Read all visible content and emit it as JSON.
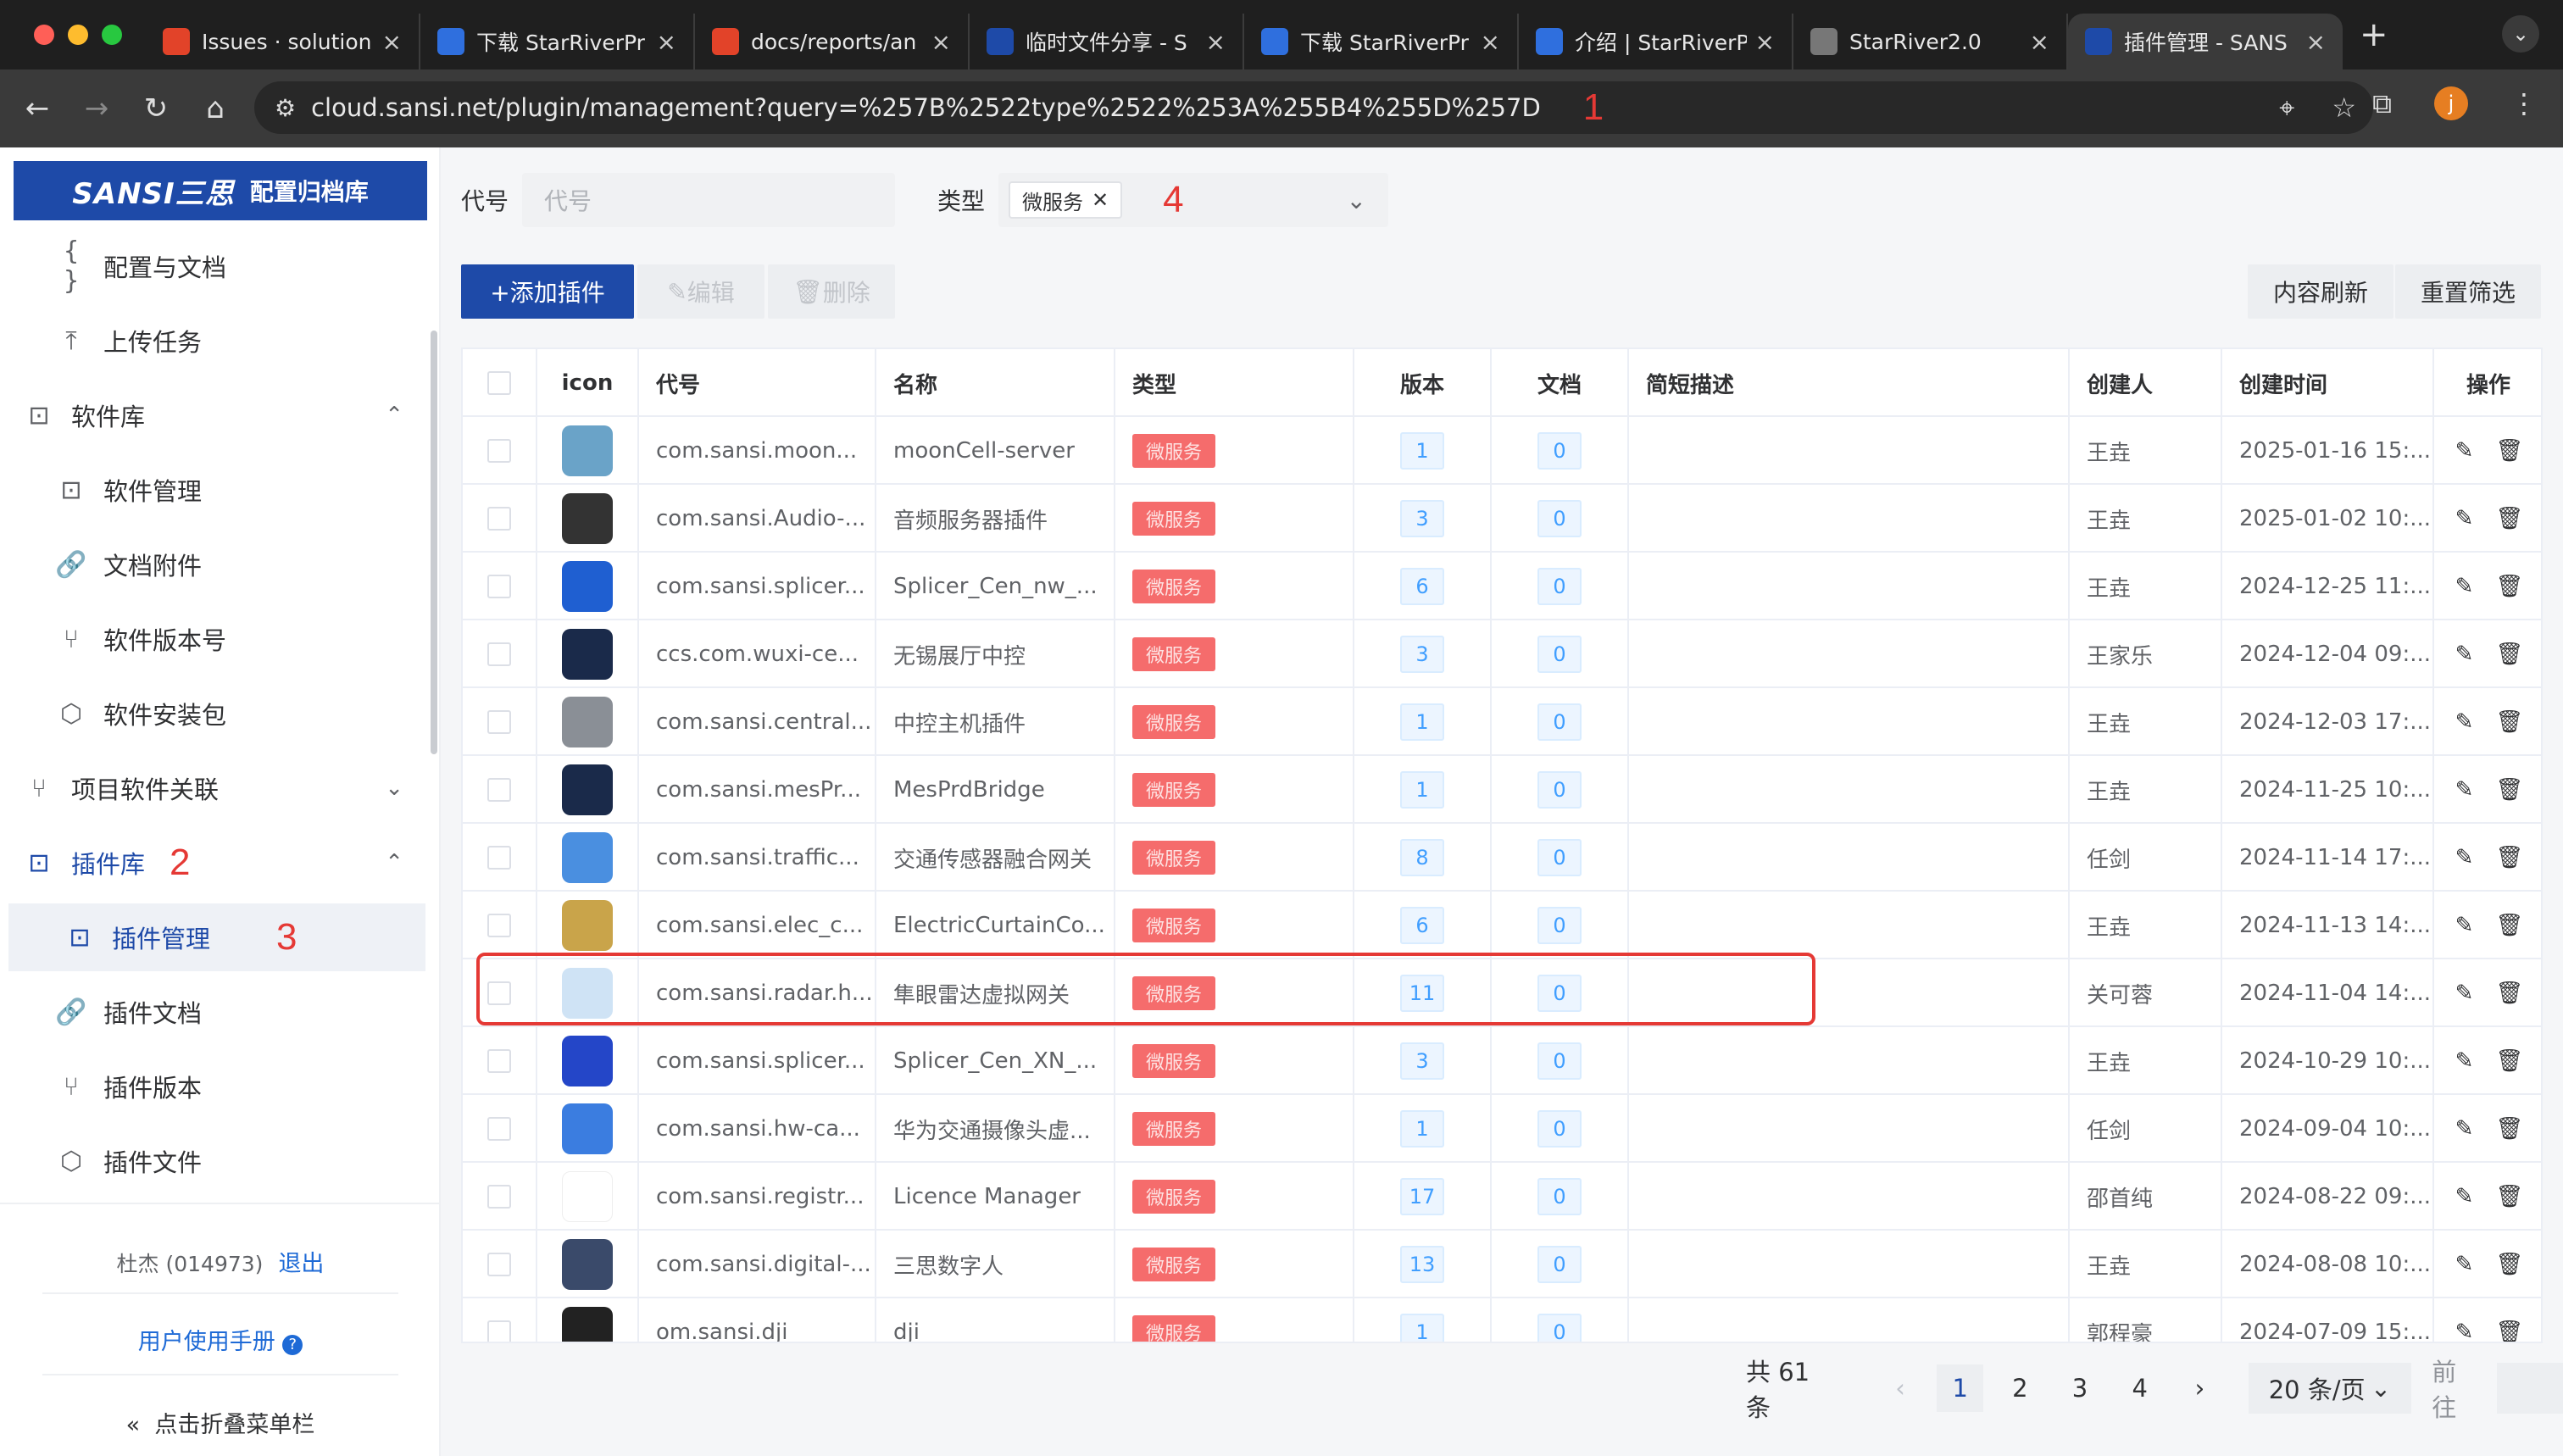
{
  "browser": {
    "tabs": [
      {
        "title": "Issues · solution",
        "fav": "gitlab-icon",
        "color": "#e24329"
      },
      {
        "title": "下载 StarRiverPr",
        "fav": "starriver-icon",
        "color": "#2f6fde"
      },
      {
        "title": "docs/reports/an",
        "fav": "gitlab-icon",
        "color": "#e24329"
      },
      {
        "title": "临时文件分享 - S",
        "fav": "sansi-icon",
        "color": "#1e4aa8"
      },
      {
        "title": "下载 StarRiverPr",
        "fav": "starriver-icon",
        "color": "#2f6fde"
      },
      {
        "title": "介绍 | StarRiverP",
        "fav": "starriver-icon",
        "color": "#2f6fde"
      },
      {
        "title": "StarRiver2.0",
        "fav": "globe-icon",
        "color": "#777777"
      },
      {
        "title": "插件管理 - SANS",
        "fav": "sansi-icon",
        "color": "#1e4aa8"
      }
    ],
    "url": "cloud.sansi.net/plugin/management?query=%257B%2522type%2522%253A%255B4%255D%257D",
    "annotation_1": "1"
  },
  "sidebar": {
    "logo_brand": "SANSI三思",
    "logo_text": "配置归档库",
    "items": [
      {
        "label": "配置与文档",
        "icon": "{ }"
      },
      {
        "label": "上传任务",
        "icon": "⤒"
      },
      {
        "label": "软件库",
        "icon": "⊡"
      },
      {
        "label": "软件管理",
        "icon": "⊡"
      },
      {
        "label": "文档附件",
        "icon": "🔗"
      },
      {
        "label": "软件版本号",
        "icon": "⑂"
      },
      {
        "label": "软件安装包",
        "icon": "⬡"
      },
      {
        "label": "项目软件关联",
        "icon": "⑂"
      },
      {
        "label": "插件库",
        "icon": "⊡"
      },
      {
        "label": "插件管理",
        "icon": "⊡"
      },
      {
        "label": "插件文档",
        "icon": "🔗"
      },
      {
        "label": "插件版本",
        "icon": "⑂"
      },
      {
        "label": "插件文件",
        "icon": "⬡"
      }
    ],
    "annotation_2": "2",
    "annotation_3": "3",
    "user": "杜杰 (014973)",
    "logout": "退出",
    "manual": "用户使用手册",
    "collapse": "点击折叠菜单栏"
  },
  "filters": {
    "code_label": "代号",
    "code_placeholder": "代号",
    "type_label": "类型",
    "type_value": "微服务",
    "annotation_4": "4"
  },
  "actions": {
    "add": "+添加插件",
    "edit": "编辑",
    "delete": "删除",
    "refresh": "内容刷新",
    "reset": "重置筛选"
  },
  "table": {
    "headers": [
      "icon",
      "代号",
      "名称",
      "类型",
      "版本",
      "文档",
      "简短描述",
      "创建人",
      "创建时间",
      "操作"
    ],
    "rows": [
      {
        "code": "com.sansi.moon...",
        "name": "moonCell-server",
        "type": "微服务",
        "version": "1",
        "docs": "0",
        "creator": "王垚",
        "created": "2025-01-16 15:...",
        "icon_color": "#6aa3c8"
      },
      {
        "code": "com.sansi.Audio-...",
        "name": "音频服务器插件",
        "type": "微服务",
        "version": "3",
        "docs": "0",
        "creator": "王垚",
        "created": "2025-01-02 10:...",
        "icon_color": "#333333"
      },
      {
        "code": "com.sansi.splicer...",
        "name": "Splicer_Cen_nw_...",
        "type": "微服务",
        "version": "6",
        "docs": "0",
        "creator": "王垚",
        "created": "2024-12-25 11:...",
        "icon_color": "#1f5fd1"
      },
      {
        "code": "ccs.com.wuxi-ce...",
        "name": "无锡展厅中控",
        "type": "微服务",
        "version": "3",
        "docs": "0",
        "creator": "王家乐",
        "created": "2024-12-04 09:...",
        "icon_color": "#1a2a4a"
      },
      {
        "code": "com.sansi.central...",
        "name": "中控主机插件",
        "type": "微服务",
        "version": "1",
        "docs": "0",
        "creator": "王垚",
        "created": "2024-12-03 17:...",
        "icon_color": "#8a8f96"
      },
      {
        "code": "com.sansi.mesPr...",
        "name": "MesPrdBridge",
        "type": "微服务",
        "version": "1",
        "docs": "0",
        "creator": "王垚",
        "created": "2024-11-25 10:...",
        "icon_color": "#1a2a4a"
      },
      {
        "code": "com.sansi.traffic...",
        "name": "交通传感器融合网关",
        "type": "微服务",
        "version": "8",
        "docs": "0",
        "creator": "任剑",
        "created": "2024-11-14 17:...",
        "icon_color": "#4a8fe0"
      },
      {
        "code": "com.sansi.elec_c...",
        "name": "ElectricCurtainCo...",
        "type": "微服务",
        "version": "6",
        "docs": "0",
        "creator": "王垚",
        "created": "2024-11-13 14:...",
        "icon_color": "#c9a44a"
      },
      {
        "code": "com.sansi.radar.h...",
        "name": "隼眼雷达虚拟网关",
        "type": "微服务",
        "version": "11",
        "docs": "0",
        "creator": "关可蓉",
        "created": "2024-11-04 14:...",
        "icon_color": "#cfe3f5"
      },
      {
        "code": "com.sansi.splicer...",
        "name": "Splicer_Cen_XN_...",
        "type": "微服务",
        "version": "3",
        "docs": "0",
        "creator": "王垚",
        "created": "2024-10-29 10:...",
        "icon_color": "#2446c8"
      },
      {
        "code": "com.sansi.hw-ca...",
        "name": "华为交通摄像头虚...",
        "type": "微服务",
        "version": "1",
        "docs": "0",
        "creator": "任剑",
        "created": "2024-09-04 10:...",
        "icon_color": "#3b7de0"
      },
      {
        "code": "com.sansi.registr...",
        "name": "Licence Manager",
        "type": "微服务",
        "version": "17",
        "docs": "0",
        "creator": "邵首纯",
        "created": "2024-08-22 09:...",
        "icon_color": "#ffffff"
      },
      {
        "code": "com.sansi.digital-...",
        "name": "三思数字人",
        "type": "微服务",
        "version": "13",
        "docs": "0",
        "creator": "王垚",
        "created": "2024-08-08 10:...",
        "icon_color": "#3a4a6a"
      },
      {
        "code": "om.sansi.dji",
        "name": "dji",
        "type": "微服务",
        "version": "1",
        "docs": "0",
        "creator": "郭程豪",
        "created": "2024-07-09 15:...",
        "icon_color": "#222222"
      }
    ]
  },
  "pagination": {
    "total": "共 61 条",
    "pages": [
      "1",
      "2",
      "3",
      "4"
    ],
    "page_size": "20 条/页",
    "goto": "前往"
  }
}
